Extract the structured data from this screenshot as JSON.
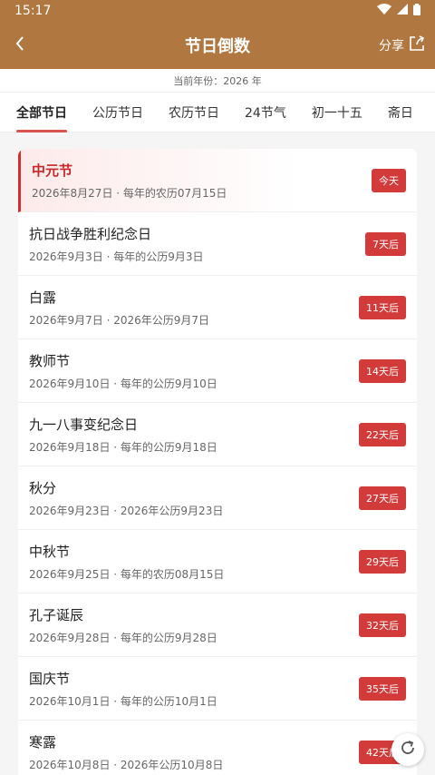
{
  "status": {
    "time": "15:17"
  },
  "header": {
    "title": "节日倒数",
    "share_label": "分享"
  },
  "year_info": "当前年份：2026 年",
  "tabs": [
    {
      "label": "全部节日",
      "active": true
    },
    {
      "label": "公历节日",
      "active": false
    },
    {
      "label": "农历节日",
      "active": false
    },
    {
      "label": "24节气",
      "active": false
    },
    {
      "label": "初一十五",
      "active": false
    },
    {
      "label": "斋日",
      "active": false
    }
  ],
  "festivals": [
    {
      "name": "中元节",
      "date": "2026年8月27日 · 每年的农历07月15日",
      "badge": "今天",
      "today": true
    },
    {
      "name": "抗日战争胜利纪念日",
      "date": "2026年9月3日 · 每年的公历9月3日",
      "badge": "7天后",
      "today": false
    },
    {
      "name": "白露",
      "date": "2026年9月7日 · 2026年公历9月7日",
      "badge": "11天后",
      "today": false
    },
    {
      "name": "教师节",
      "date": "2026年9月10日 · 每年的公历9月10日",
      "badge": "14天后",
      "today": false
    },
    {
      "name": "九一八事变纪念日",
      "date": "2026年9月18日 · 每年的公历9月18日",
      "badge": "22天后",
      "today": false
    },
    {
      "name": "秋分",
      "date": "2026年9月23日 · 2026年公历9月23日",
      "badge": "27天后",
      "today": false
    },
    {
      "name": "中秋节",
      "date": "2026年9月25日 · 每年的农历08月15日",
      "badge": "29天后",
      "today": false
    },
    {
      "name": "孔子诞辰",
      "date": "2026年9月28日 · 每年的公历9月28日",
      "badge": "32天后",
      "today": false
    },
    {
      "name": "国庆节",
      "date": "2026年10月1日 · 每年的公历10月1日",
      "badge": "35天后",
      "today": false
    },
    {
      "name": "寒露",
      "date": "2026年10月8日 · 2026年公历10月8日",
      "badge": "42天后",
      "today": false
    }
  ],
  "colors": {
    "header_bg": "#b07840",
    "accent": "#d33b3b"
  },
  "icons": {
    "back": "chevron-left-icon",
    "share": "share-icon",
    "refresh": "refresh-icon"
  }
}
